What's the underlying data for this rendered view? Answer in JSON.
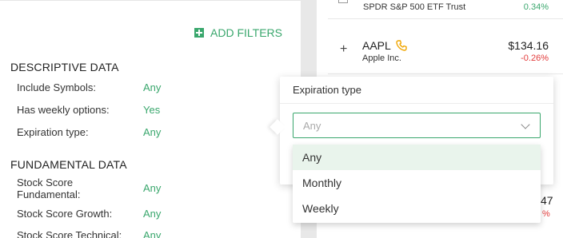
{
  "colors": {
    "accent": "#3aa76d",
    "negative": "#e23a3a",
    "option_highlight": "#e9f4ec"
  },
  "filters_panel": {
    "add_filters_label": "ADD FILTERS",
    "sections": [
      {
        "title": "DESCRIPTIVE DATA",
        "rows": [
          {
            "label": "Include Symbols:",
            "value": "Any"
          },
          {
            "label": "Has weekly options:",
            "value": "Yes"
          },
          {
            "label": "Expiration type:",
            "value": "Any"
          }
        ]
      },
      {
        "title": "FUNDAMENTAL DATA",
        "rows": [
          {
            "label_line1": "Stock Score",
            "label_line2": "Fundamental:",
            "value": "Any"
          },
          {
            "label": "Stock Score Growth:",
            "value": "Any"
          },
          {
            "label": "Stock Score Technical:",
            "value": "Any"
          }
        ]
      }
    ]
  },
  "watchlist": {
    "rows": [
      {
        "name": "SPDR S&P 500 ETF Trust",
        "change": "0.34%"
      },
      {
        "symbol": "AAPL",
        "name": "Apple Inc.",
        "price": "$134.16",
        "change": "-0.26%",
        "icon": "phone-icon"
      }
    ],
    "peek_price_fragment": "47",
    "peek_change_fragment": "%"
  },
  "popover": {
    "title": "Expiration type",
    "select_value": "Any",
    "options": [
      "Any",
      "Monthly",
      "Weekly"
    ],
    "selected_index": 0
  }
}
